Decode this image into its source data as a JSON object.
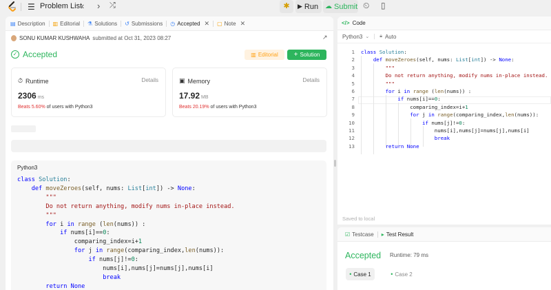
{
  "topbar": {
    "problem_list": "Problem List",
    "run_label": "Run",
    "submit_label": "Submit"
  },
  "left_tabs": [
    {
      "label": "Description",
      "icon": "document-icon"
    },
    {
      "label": "Editorial",
      "icon": "book-icon"
    },
    {
      "label": "Solutions",
      "icon": "flask-icon"
    },
    {
      "label": "Submissions",
      "icon": "history-icon"
    },
    {
      "label": "Accepted",
      "icon": "clock-icon"
    },
    {
      "label": "Note",
      "icon": "note-icon"
    }
  ],
  "submission": {
    "user": "SONU KUMAR KUSHWAHA",
    "submitted_text": "submitted at Oct 31, 2023 08:27",
    "status": "Accepted",
    "editorial_label": "Editorial",
    "solution_label": "Solution"
  },
  "runtime": {
    "title": "Runtime",
    "details": "Details",
    "value": "2306",
    "unit": "ms",
    "beats_pct": "Beats 5.60%",
    "beats_rest": "of users with Python3"
  },
  "memory": {
    "title": "Memory",
    "details": "Details",
    "value": "17.92",
    "unit": "MB",
    "beats_pct": "Beats 20.19%",
    "beats_rest": "of users with Python3"
  },
  "left_code": {
    "language": "Python3",
    "lines": [
      "class Solution:",
      "    def moveZeroes(self, nums: List[int]) -> None:",
      "        \"\"\"",
      "        Do not return anything, modify nums in-place instead.",
      "        \"\"\"",
      "        for i in range (len(nums)) :",
      "            if nums[i]==0:",
      "                comparing_index=i+1",
      "                for j in range(comparing_index,len(nums)):",
      "                    if nums[j]!=0:",
      "                        nums[i],nums[j]=nums[j],nums[i]",
      "                        break",
      "        return None"
    ]
  },
  "code_panel": {
    "tab_label": "Code",
    "language": "Python3",
    "mode": "Auto",
    "saved_text": "Saved to local",
    "line_numbers": [
      "1",
      "2",
      "3",
      "4",
      "5",
      "6",
      "7",
      "8",
      "9",
      "10",
      "11",
      "12",
      "13"
    ],
    "lines": [
      "class Solution:",
      "    def moveZeroes(self, nums: List[int]) -> None:",
      "        \"\"\"",
      "        Do not return anything, modify nums in-place instead.",
      "        \"\"\"",
      "        for i in range (len(nums)) :",
      "            if nums[i]==0:",
      "                comparing_index=i+1",
      "                for j in range(comparing_index,len(nums)):",
      "                    if nums[j]!=0:",
      "                        nums[i],nums[j]=nums[j],nums[i]",
      "                        break",
      "        return None"
    ]
  },
  "result_panel": {
    "tabs": [
      "Testcase",
      "Test Result"
    ],
    "status": "Accepted",
    "runtime": "Runtime: 79 ms",
    "cases": [
      "Case 1",
      "Case 2"
    ]
  },
  "colors": {
    "accent_green": "#2db55d",
    "accent_orange": "#ffa116",
    "beats_red": "#e03131"
  }
}
